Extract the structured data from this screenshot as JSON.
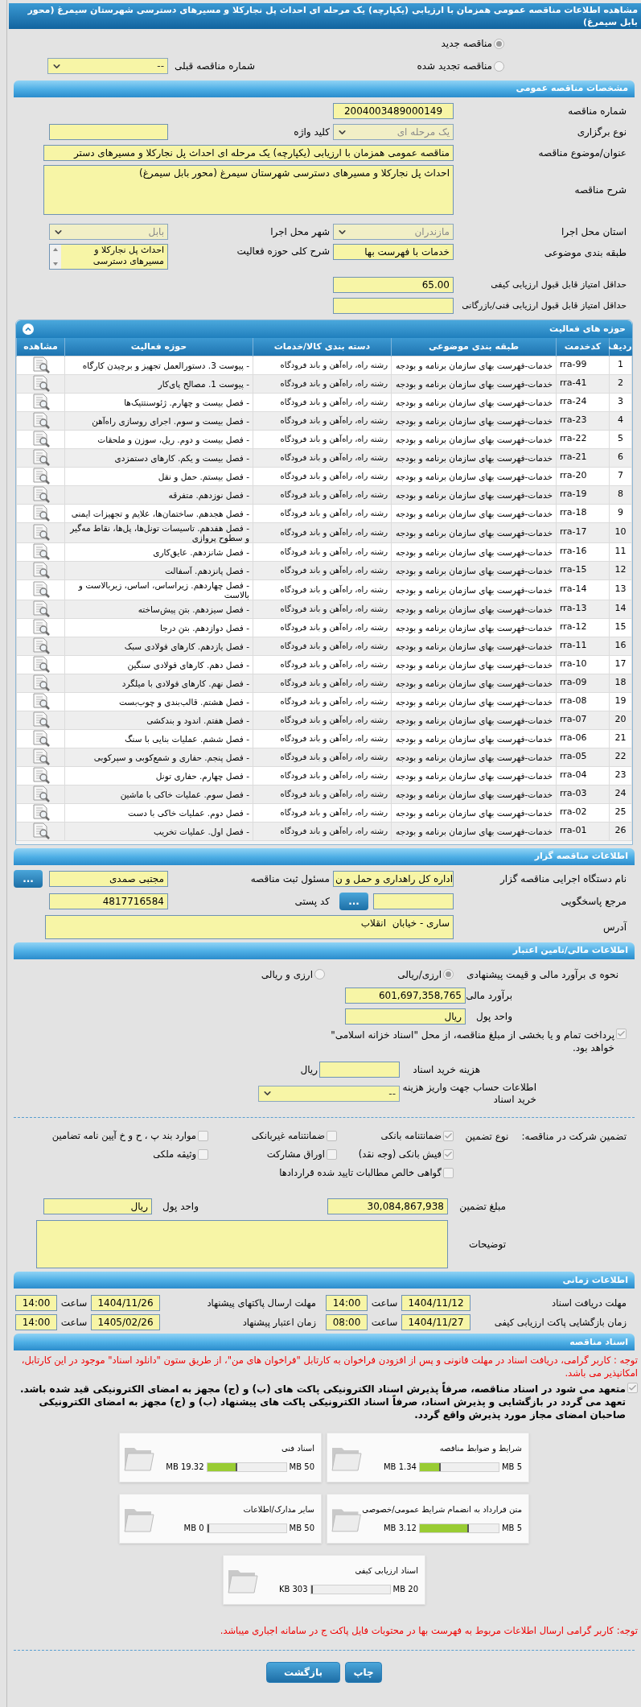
{
  "title": "مشاهده اطلاعات مناقصه عمومی همزمان با ارزیابی (یکپارچه) یک مرحله ای احداث پل نجارکلا و مسیرهای دسترسی شهرستان سیمرغ (محور بابل سیمرغ)",
  "tender_kind": [
    {
      "label": "مناقصه جدید",
      "selected": true
    },
    {
      "label": "مناقصه تجدید شده",
      "selected": false
    }
  ],
  "previous_tender": {
    "label": "شماره مناقصه قبلی",
    "value": "--",
    "disabled": false
  },
  "general": {
    "header": "مشخصات مناقصه عمومی",
    "tender_number": {
      "label": "شماره مناقصه",
      "value": "2004003489000149"
    },
    "holding_type": {
      "label": "نوع برگزاری",
      "value": "یک مرحله ای",
      "disabled": true
    },
    "keyword": {
      "label": "کلید واژه"
    },
    "subject": {
      "label": "عنوان/موضوع مناقصه",
      "value": "مناقصه عمومی همزمان با ارزیابی (یکپارچه) یک مرحله ای احداث پل نجارکلا و مسیرهای دستر"
    },
    "description": {
      "label": "شرح مناقصه",
      "value": "احداث پل نجارکلا و مسیرهای دسترسی شهرستان سیمرغ (محور بابل سیمرغ)"
    },
    "province": {
      "label": "استان محل اجرا",
      "value": "مازندران",
      "disabled": true
    },
    "city": {
      "label": "شهر محل اجرا",
      "value": "بابل",
      "disabled": true
    },
    "subject_class": {
      "label": "طبقه بندی موضوعی",
      "value": "خدمات با فهرست بها"
    },
    "activity_summary": {
      "label": "شرح کلی حوزه فعالیت",
      "value": "احداث پل نجارکلا و مسیرهای دسترسی"
    },
    "min_quality_score": {
      "label": "حداقل امتیاز قابل قبول ارزیابی کیفی",
      "value": "65.00"
    },
    "min_technical_score": {
      "label": "حداقل امتیاز قابل قبول ارزیابی فنی/بازرگانی"
    }
  },
  "activities": {
    "header": "حوزه های فعالیت",
    "columns": [
      "ردیف",
      "کدخدمت",
      "طبقه بندی موضوعی",
      "دسته بندی کالا/خدمات",
      "حوزه فعالیت",
      "مشاهده"
    ],
    "rows": [
      {
        "no": "1",
        "code": "rra-99",
        "category": "خدمات-فهرست بهای سازمان برنامه و بودجه",
        "goods": "رشته راه، راه‌آهن و باند فرودگاه",
        "activity": "- پیوست 3. دستورالعمل تجهیز و برچیدن کارگاه"
      },
      {
        "no": "2",
        "code": "rra-41",
        "category": "خدمات-فهرست بهای سازمان برنامه و بودجه",
        "goods": "رشته راه، راه‌آهن و باند فرودگاه",
        "activity": "- پیوست 1. مصالح پای‌کار"
      },
      {
        "no": "3",
        "code": "rra-24",
        "category": "خدمات-فهرست بهای سازمان برنامه و بودجه",
        "goods": "رشته راه، راه‌آهن و باند فرودگاه",
        "activity": "- فصل بیست و چهارم. ژئوسنتتیک‌ها"
      },
      {
        "no": "4",
        "code": "rra-23",
        "category": "خدمات-فهرست بهای سازمان برنامه و بودجه",
        "goods": "رشته راه، راه‌آهن و باند فرودگاه",
        "activity": "- فصل بیست و سوم. اجرای روسازی راه‌آهن"
      },
      {
        "no": "5",
        "code": "rra-22",
        "category": "خدمات-فهرست بهای سازمان برنامه و بودجه",
        "goods": "رشته راه، راه‌آهن و باند فرودگاه",
        "activity": "- فصل بیست و دوم. ریل، سوزن و ملحقات"
      },
      {
        "no": "6",
        "code": "rra-21",
        "category": "خدمات-فهرست بهای سازمان برنامه و بودجه",
        "goods": "رشته راه، راه‌آهن و باند فرودگاه",
        "activity": "- فصل بیست و یکم. کارهای دستمزدی"
      },
      {
        "no": "7",
        "code": "rra-20",
        "category": "خدمات-فهرست بهای سازمان برنامه و بودجه",
        "goods": "رشته راه، راه‌آهن و باند فرودگاه",
        "activity": "- فصل بیستم. حمل و نقل"
      },
      {
        "no": "8",
        "code": "rra-19",
        "category": "خدمات-فهرست بهای سازمان برنامه و بودجه",
        "goods": "رشته راه، راه‌آهن و باند فرودگاه",
        "activity": "- فصل نوزدهم. متفرقه"
      },
      {
        "no": "9",
        "code": "rra-18",
        "category": "خدمات-فهرست بهای سازمان برنامه و بودجه",
        "goods": "رشته راه، راه‌آهن و باند فرودگاه",
        "activity": "- فصل هجدهم. ساختمان‌ها، علایم و تجهیزات ایمنی"
      },
      {
        "no": "10",
        "code": "rra-17",
        "category": "خدمات-فهرست بهای سازمان برنامه و بودجه",
        "goods": "رشته راه، راه‌آهن و باند فرودگاه",
        "activity": "- فصل هفدهم. تاسیسات تونل‌ها، پل‌ها، نقاط مه‌گیر و سطوح پروازی"
      },
      {
        "no": "11",
        "code": "rra-16",
        "category": "خدمات-فهرست بهای سازمان برنامه و بودجه",
        "goods": "رشته راه، راه‌آهن و باند فرودگاه",
        "activity": "- فصل شانزدهم. عایق‌کاری"
      },
      {
        "no": "12",
        "code": "rra-15",
        "category": "خدمات-فهرست بهای سازمان برنامه و بودجه",
        "goods": "رشته راه، راه‌آهن و باند فرودگاه",
        "activity": "- فصل پانزدهم. آسفالت"
      },
      {
        "no": "13",
        "code": "rra-14",
        "category": "خدمات-فهرست بهای سازمان برنامه و بودجه",
        "goods": "رشته راه، راه‌آهن و باند فرودگاه",
        "activity": "- فصل چهاردهم. زیراساس، اساس، زیربالاست  و بالاست"
      },
      {
        "no": "14",
        "code": "rra-13",
        "category": "خدمات-فهرست بهای سازمان برنامه و بودجه",
        "goods": "رشته راه، راه‌آهن و باند فرودگاه",
        "activity": "- فصل سیزدهم. بتن پیش‌ساخته"
      },
      {
        "no": "15",
        "code": "rra-12",
        "category": "خدمات-فهرست بهای سازمان برنامه و بودجه",
        "goods": "رشته راه، راه‌آهن و باند فرودگاه",
        "activity": "- فصل دوازدهم. بتن درجا"
      },
      {
        "no": "16",
        "code": "rra-11",
        "category": "خدمات-فهرست بهای سازمان برنامه و بودجه",
        "goods": "رشته راه، راه‌آهن و باند فرودگاه",
        "activity": "- فصل یازدهم. کارهای فولادی سبک"
      },
      {
        "no": "17",
        "code": "rra-10",
        "category": "خدمات-فهرست بهای سازمان برنامه و بودجه",
        "goods": "رشته راه، راه‌آهن و باند فرودگاه",
        "activity": "- فصل دهم. کارهای فولادی سنگین"
      },
      {
        "no": "18",
        "code": "rra-09",
        "category": "خدمات-فهرست بهای سازمان برنامه و بودجه",
        "goods": "رشته راه، راه‌آهن و باند فرودگاه",
        "activity": "- فصل نهم. کارهای فولادی با میلگرد"
      },
      {
        "no": "19",
        "code": "rra-08",
        "category": "خدمات-فهرست بهای سازمان برنامه و بودجه",
        "goods": "رشته راه، راه‌آهن و باند فرودگاه",
        "activity": "- فصل هشتم. قالب‌بندی و چوب‌بست"
      },
      {
        "no": "20",
        "code": "rra-07",
        "category": "خدمات-فهرست بهای سازمان برنامه و بودجه",
        "goods": "رشته راه، راه‌آهن و باند فرودگاه",
        "activity": "- فصل هفتم. اندود و بندکشی"
      },
      {
        "no": "21",
        "code": "rra-06",
        "category": "خدمات-فهرست بهای سازمان برنامه و بودجه",
        "goods": "رشته راه، راه‌آهن و باند فرودگاه",
        "activity": "- فصل ششم. عملیات بنایی با سنگ"
      },
      {
        "no": "22",
        "code": "rra-05",
        "category": "خدمات-فهرست بهای سازمان برنامه و بودجه",
        "goods": "رشته راه، راه‌آهن و باند فرودگاه",
        "activity": "- فصل پنجم. حفاری و شمع‌کوبی و سپرکوبی"
      },
      {
        "no": "23",
        "code": "rra-04",
        "category": "خدمات-فهرست بهای سازمان برنامه و بودجه",
        "goods": "رشته راه، راه‌آهن و باند فرودگاه",
        "activity": "- فصل چهارم. حفاری تونل"
      },
      {
        "no": "24",
        "code": "rra-03",
        "category": "خدمات-فهرست بهای سازمان برنامه و بودجه",
        "goods": "رشته راه، راه‌آهن و باند فرودگاه",
        "activity": "- فصل سوم. عملیات خاکی با ماشین"
      },
      {
        "no": "25",
        "code": "rra-02",
        "category": "خدمات-فهرست بهای سازمان برنامه و بودجه",
        "goods": "رشته راه، راه‌آهن و باند فرودگاه",
        "activity": "- فصل دوم. عملیات خاکی با دست"
      },
      {
        "no": "26",
        "code": "rra-01",
        "category": "خدمات-فهرست بهای سازمان برنامه و بودجه",
        "goods": "رشته راه، راه‌آهن و باند فرودگاه",
        "activity": "- فصل اول. عملیات تخریب"
      }
    ]
  },
  "tenderer": {
    "header": "اطلاعات مناقصه گزار",
    "agency": {
      "label": "نام دستگاه اجرایی مناقصه گزار",
      "value": "اداره کل راهداری و حمل و ن"
    },
    "registrar": {
      "label": "مسئول ثبت مناقصه",
      "value": "مجتبی صمدی",
      "button": "..."
    },
    "reference": {
      "label": "مرجع پاسخگویی",
      "button": "..."
    },
    "postal_code": {
      "label": "کد پستی",
      "value": "4817716584"
    },
    "address": {
      "label": "آدرس",
      "value": "ساری - خیابان  انقلاب"
    }
  },
  "finance": {
    "header": "اطلاعات مالی/تامین اعتبار",
    "estimate_method": {
      "label": "نحوه ی برآورد مالی و قیمت پیشنهادی",
      "options": [
        {
          "label": "ارزی/ریالی",
          "selected": true
        },
        {
          "label": "ارزی و ریالی",
          "selected": false
        }
      ]
    },
    "estimate": {
      "label": "برآورد مالی",
      "value": "601,697,358,765"
    },
    "currency": {
      "label": "واحد پول",
      "value": "ریال"
    },
    "treasury": {
      "label": "پرداخت تمام و یا بخشی از مبلغ مناقصه، از محل \"اسناد خزانه اسلامی\" خواهد بود.",
      "checked": true
    },
    "document_fee": {
      "label": "هزینه خرید اسناد",
      "unit": "ریال"
    },
    "account": {
      "label": "اطلاعات حساب جهت واریز هزینه خرید اسناد",
      "value": "--",
      "disabled": false
    }
  },
  "guarantee": {
    "label": "تضمین شرکت در مناقصه:",
    "type_label": "نوع تضمین",
    "types": [
      {
        "label": "ضمانتنامه بانکی",
        "checked": true
      },
      {
        "label": "ضمانتنامه غیربانکی",
        "checked": false
      },
      {
        "label": "موارد بند پ ، ح و خ آیین نامه تضامین",
        "checked": false
      },
      {
        "label": "فیش بانکی (وجه نقد)",
        "checked": true
      },
      {
        "label": "اوراق مشارکت",
        "checked": false
      },
      {
        "label": "وثیقه ملکی",
        "checked": false
      },
      {
        "label": "گواهی خالص مطالبات تایید شده قراردادها",
        "checked": false
      }
    ],
    "amount": {
      "label": "مبلغ تضمین",
      "value": "30,084,867,938"
    },
    "currency": {
      "label": "واحد پول",
      "value": "ریال"
    },
    "notes": {
      "label": "توضیحات"
    }
  },
  "schedule": {
    "header": "اطلاعات زمانی",
    "items": [
      {
        "label": "مهلت دریافت اسناد",
        "date": "1404/11/12",
        "time_label": "ساعت",
        "time": "14:00"
      },
      {
        "label": "مهلت ارسال پاکتهای پیشنهاد",
        "date": "1404/11/26",
        "time_label": "ساعت",
        "time": "14:00"
      },
      {
        "label": "زمان بازگشایی پاکت ارزیابی کیفی",
        "date": "1404/11/27",
        "time_label": "ساعت",
        "time": "08:00"
      },
      {
        "label": "زمان اعتبار پیشنهاد",
        "date": "1405/02/26",
        "time_label": "ساعت",
        "time": "14:00"
      }
    ]
  },
  "documents": {
    "header": "اسناد مناقصه",
    "notice": "توجه : کاربر گرامی، دریافت اسناد در مهلت قانونی و پس از افزودن فراخوان به کارتابل \"فراخوان های من\"، از طریق ستون \"دانلود اسناد\" موجود در این کارتابل، امکانپذیر می باشد.",
    "commitment": {
      "text": "متعهد می شود در اسناد مناقصه، صرفاً پذیرش اسناد الکترونیکی پاکت های (ب) و (ج) مجهز به امضای الکترونیکی قید شده باشد. تعهد می گردد در بازگشایی و پذیرش اسناد، صرفاً اسناد الکترونیکی پاکت های پیشنهاد (ب) و (ج) مجهز به امضای الکترونیکی صاحبان امضای مجاز مورد پذیرش واقع گردد.",
      "checked": true
    },
    "files": [
      {
        "title": "شرایط و ضوابط مناقصه",
        "limit": "5 MB",
        "used": "1.34 MB",
        "level": 0.268
      },
      {
        "title": "اسناد فنی",
        "limit": "50 MB",
        "used": "19.32 MB",
        "level": 0.386
      },
      {
        "title": "متن قرارداد به انضمام شرایط عمومی/خصوصی",
        "limit": "5 MB",
        "used": "3.12 MB",
        "level": 0.624
      },
      {
        "title": "سایر مدارک/اطلاعات",
        "limit": "50 MB",
        "used": "0 MB",
        "level": 0
      },
      {
        "title": "اسناد ارزیابی کیفی",
        "limit": "20 MB",
        "used": "303 KB",
        "level": 0.015
      }
    ],
    "footnote": "توجه: کاربر گرامی ارسال اطلاعات مربوط به فهرست بها در محتوبات فایل پاکت ج در سامانه اجباری میباشد."
  },
  "buttons": [
    "چاپ",
    "بازگشت"
  ]
}
